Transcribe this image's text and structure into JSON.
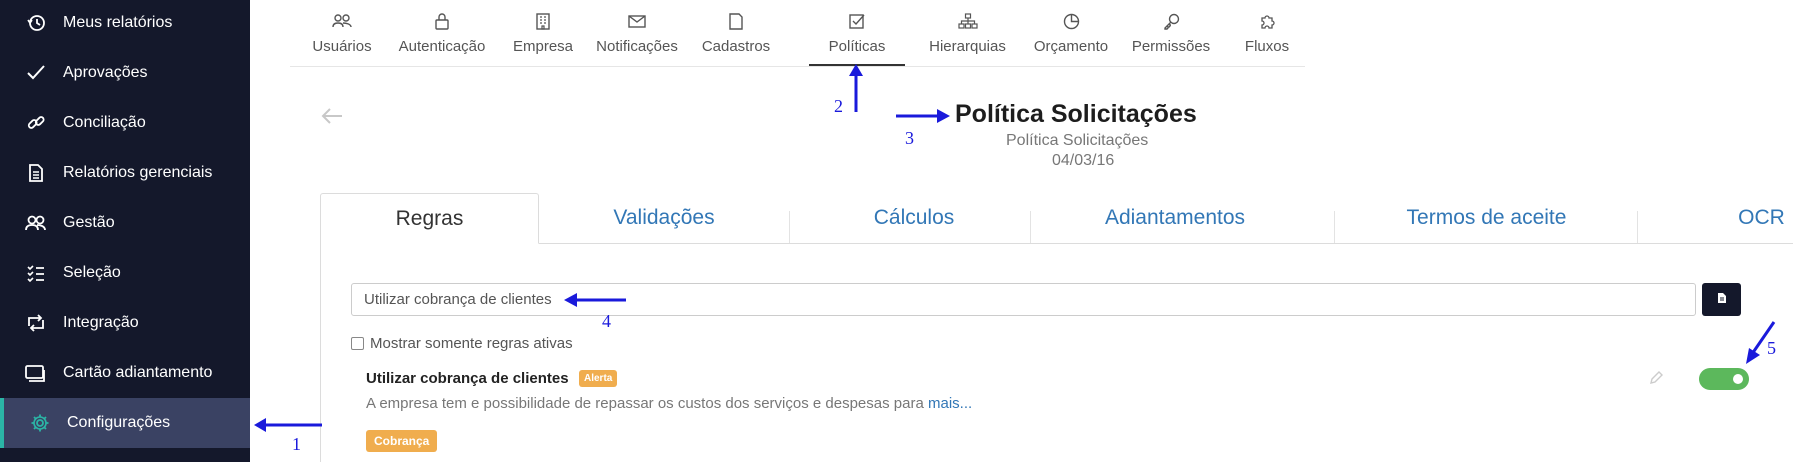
{
  "sidebar": {
    "items": [
      {
        "label": "Meus relatórios",
        "icon": "history-icon"
      },
      {
        "label": "Aprovações",
        "icon": "check-icon"
      },
      {
        "label": "Conciliação",
        "icon": "link-icon"
      },
      {
        "label": "Relatórios gerenciais",
        "icon": "document-icon"
      },
      {
        "label": "Gestão",
        "icon": "users-icon"
      },
      {
        "label": "Seleção",
        "icon": "checklist-icon"
      },
      {
        "label": "Integração",
        "icon": "sync-icon"
      },
      {
        "label": "Cartão adiantamento",
        "icon": "card-icon"
      },
      {
        "label": "Configurações",
        "icon": "gear-icon",
        "active": true
      }
    ],
    "accent": "#2bb5a6",
    "background": "#14182b"
  },
  "topnav": {
    "tabs": [
      {
        "label": "Usuários",
        "icon": "users-icon"
      },
      {
        "label": "Autenticação",
        "icon": "lock-icon"
      },
      {
        "label": "Empresa",
        "icon": "building-icon"
      },
      {
        "label": "Notificações",
        "icon": "envelope-icon"
      },
      {
        "label": "Cadastros",
        "icon": "file-icon"
      },
      {
        "label": "Políticas",
        "icon": "checkbox-icon",
        "active": true
      },
      {
        "label": "Hierarquias",
        "icon": "hierarchy-icon"
      },
      {
        "label": "Orçamento",
        "icon": "pie-chart-icon"
      },
      {
        "label": "Permissões",
        "icon": "key-icon"
      },
      {
        "label": "Fluxos",
        "icon": "puzzle-icon"
      }
    ]
  },
  "page": {
    "title": "Política Solicitações",
    "subtitle": "Política Solicitações",
    "date": "04/03/16"
  },
  "subtabs": [
    "Regras",
    "Validações",
    "Cálculos",
    "Adiantamentos",
    "Termos de aceite",
    "OCR"
  ],
  "search": {
    "value": "Utilizar cobrança de clientes"
  },
  "filter": {
    "checkbox_label": "Mostrar somente regras ativas",
    "checked": false
  },
  "rule": {
    "title": "Utilizar cobrança de clientes",
    "badge": "Alerta",
    "description": "A empresa tem e possibilidade de repassar os custos dos serviços e despesas para",
    "more_link": "mais...",
    "tag": "Cobrança",
    "enabled": true
  },
  "annotations": [
    "1",
    "2",
    "3",
    "4",
    "5"
  ],
  "colors": {
    "link": "#3277b6",
    "badge": "#f0ad4e",
    "toggle_on": "#5cb85c",
    "annotation": "#1a1adb"
  }
}
